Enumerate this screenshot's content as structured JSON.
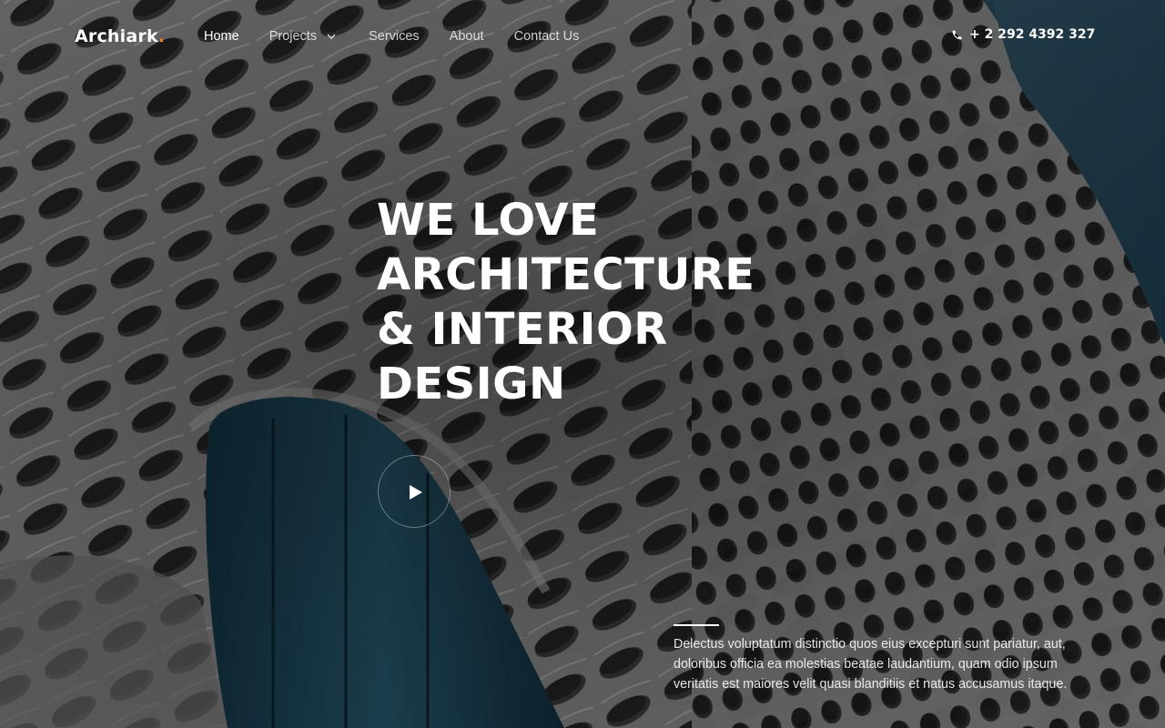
{
  "header": {
    "logo_text": "Archiark",
    "logo_dot": ".",
    "phone": "+ 2 292 4392 327"
  },
  "nav": {
    "items": [
      {
        "label": "Home",
        "active": true
      },
      {
        "label": "Projects",
        "has_dropdown": true
      },
      {
        "label": "Services"
      },
      {
        "label": "About"
      },
      {
        "label": "Contact Us"
      }
    ]
  },
  "hero": {
    "headline_lines": [
      "WE LOVE",
      "ARCHITECTURE",
      "& INTERIOR",
      "DESIGN"
    ],
    "description": "Delectus voluptatum distinctio quos eius excepturi sunt pariatur, aut, doloribus officia ea molestias beatae laudantium, quam odio ipsum veritatis est maiores velit quasi blanditiis et natus accusamus itaque."
  },
  "icons": {
    "phone": "phone-icon",
    "play": "play-icon",
    "dropdown": "chevron-down-icon"
  },
  "colors": {
    "accent": "#e67e22",
    "text": "#ffffff",
    "sky": "#1d3a4a",
    "facade": "#6a6a6a"
  }
}
